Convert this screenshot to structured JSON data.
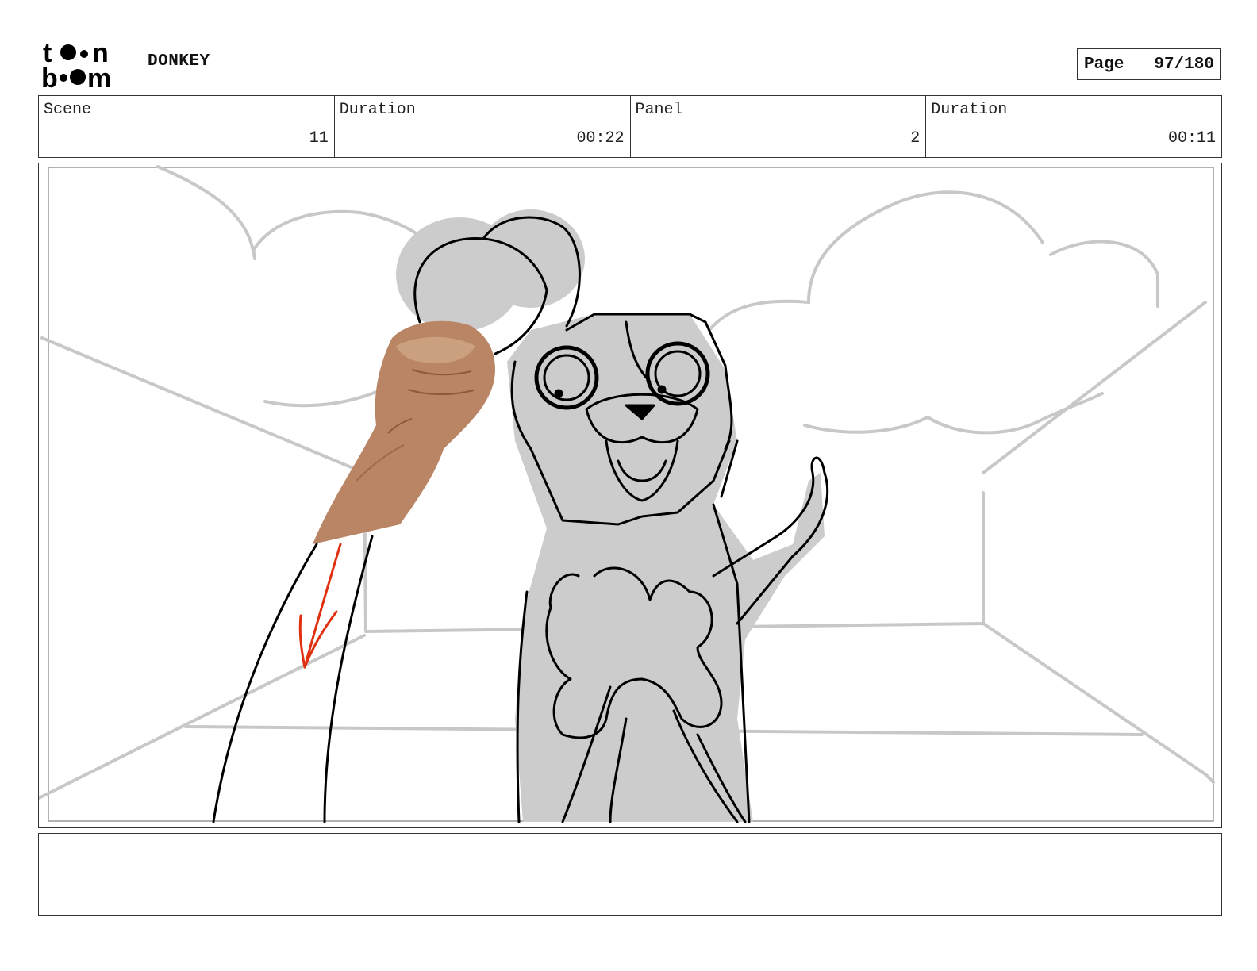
{
  "header": {
    "logo_lines": [
      "toon",
      "boom"
    ],
    "project": "DONKEY",
    "page_label": "Page",
    "page_value": "97/180"
  },
  "info": [
    {
      "label": "Scene",
      "value": "11"
    },
    {
      "label": "Duration",
      "value": "00:22"
    },
    {
      "label": "Panel",
      "value": "2"
    },
    {
      "label": "Duration",
      "value": "00:11"
    }
  ],
  "panel": {
    "sketch_color": "#000000",
    "background_line_color": "#c8c8c8",
    "fill_color": "#cccccc",
    "arrow_color": "#e03010",
    "skin_color": "#b98565"
  },
  "notes": {
    "text": ""
  }
}
